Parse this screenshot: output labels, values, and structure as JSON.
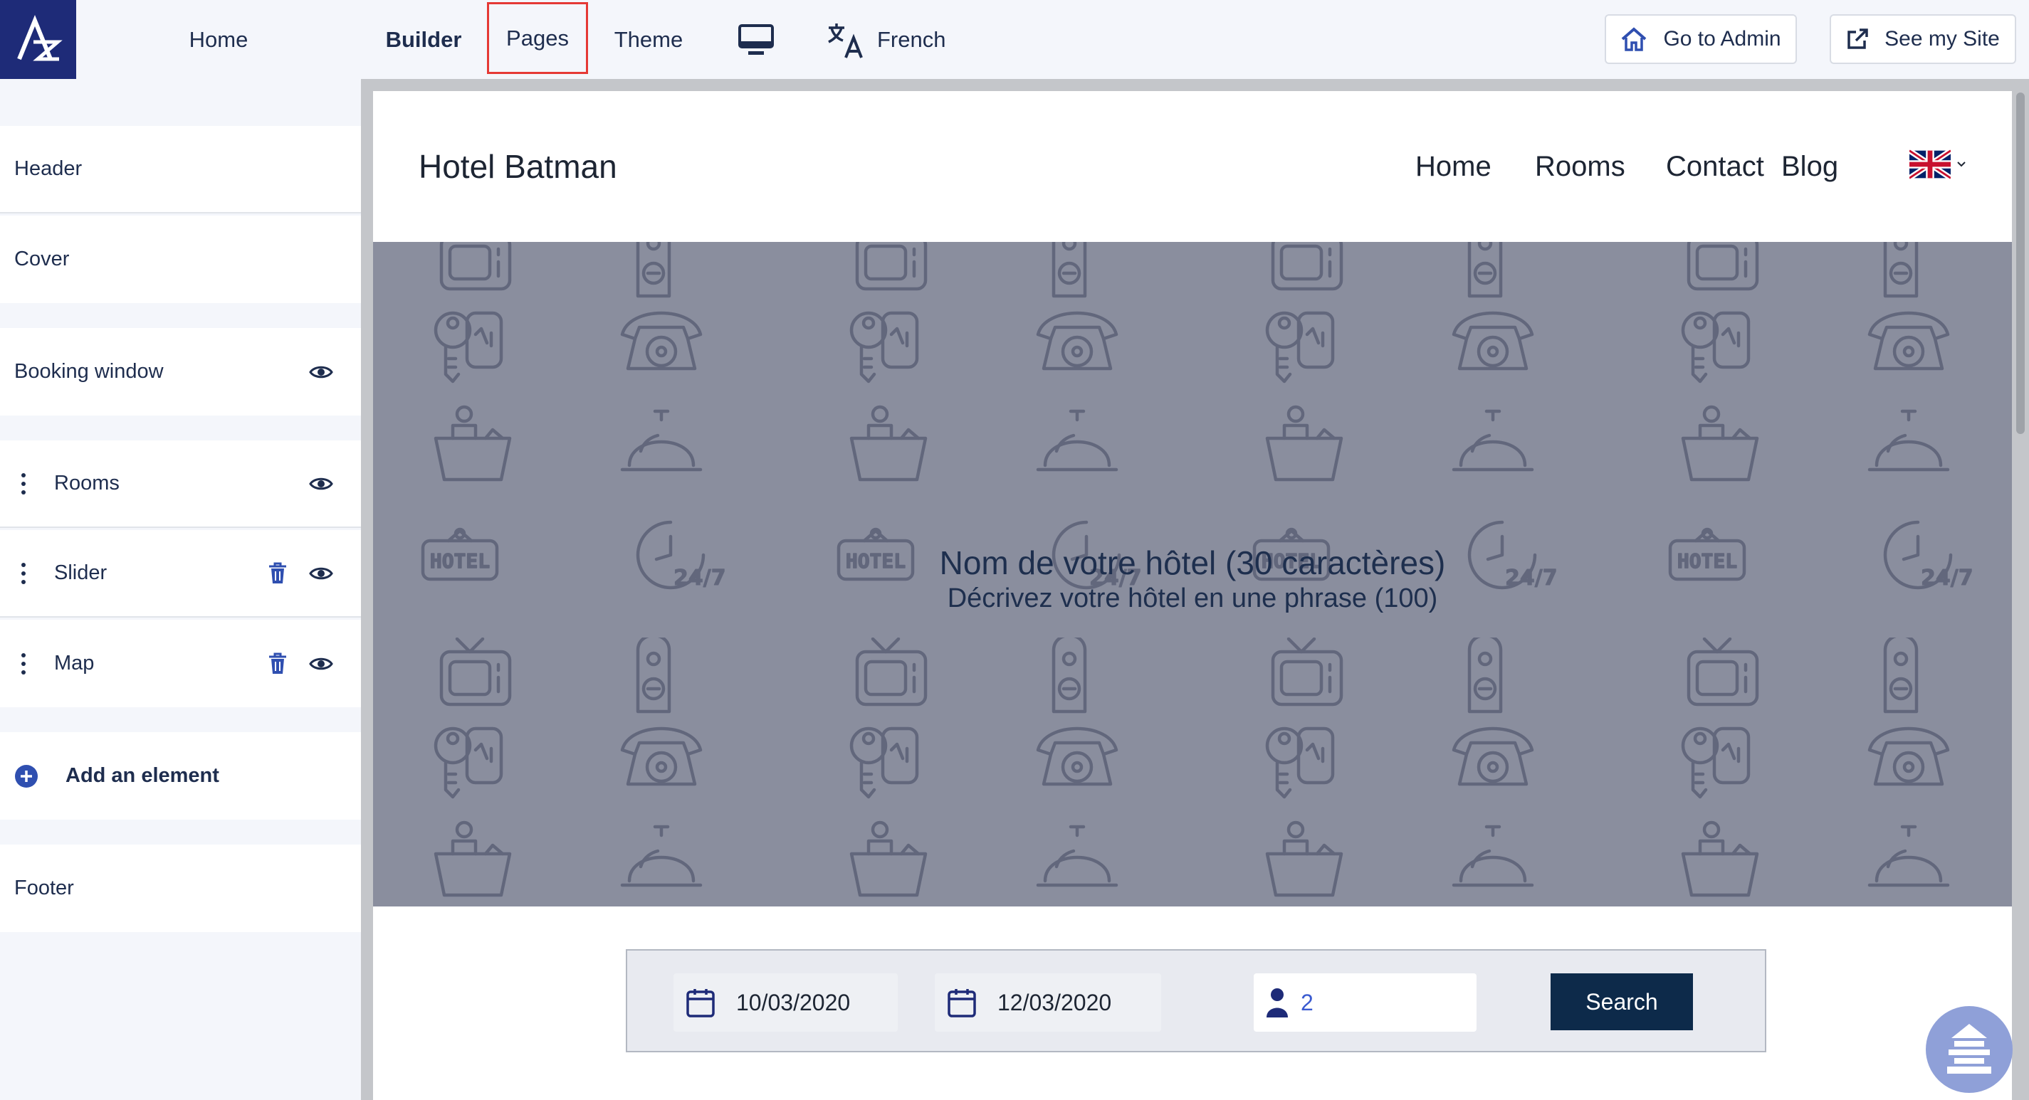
{
  "topbar": {
    "home": "Home",
    "tabs": {
      "builder": "Builder",
      "pages": "Pages",
      "theme": "Theme"
    },
    "language": "French",
    "go_admin": "Go to Admin",
    "see_site": "See my Site",
    "icons": {
      "device": "desktop-icon",
      "language": "translate-icon",
      "admin": "house-icon",
      "site": "external-link-icon"
    }
  },
  "sidebar": {
    "items": {
      "header": "Header",
      "cover": "Cover",
      "booking": "Booking window",
      "rooms": "Rooms",
      "slider": "Slider",
      "map": "Map",
      "add": "Add an element",
      "footer": "Footer"
    }
  },
  "preview": {
    "site_title": "Hotel Batman",
    "nav": {
      "home": "Home",
      "rooms": "Rooms",
      "contact": "Contact",
      "blog": "Blog"
    },
    "cover": {
      "title": "Nom de votre hôtel (30 caractères)",
      "subtitle": "Décrivez votre hôtel en une phrase (100)"
    },
    "booking": {
      "checkin": "10/03/2020",
      "checkout": "12/03/2020",
      "guests": "2",
      "search": "Search"
    }
  },
  "colors": {
    "brand": "#1e2b78",
    "cover_bg": "#8a8e9e",
    "search_btn": "#0d2a4a",
    "highlight": "#e53935"
  }
}
